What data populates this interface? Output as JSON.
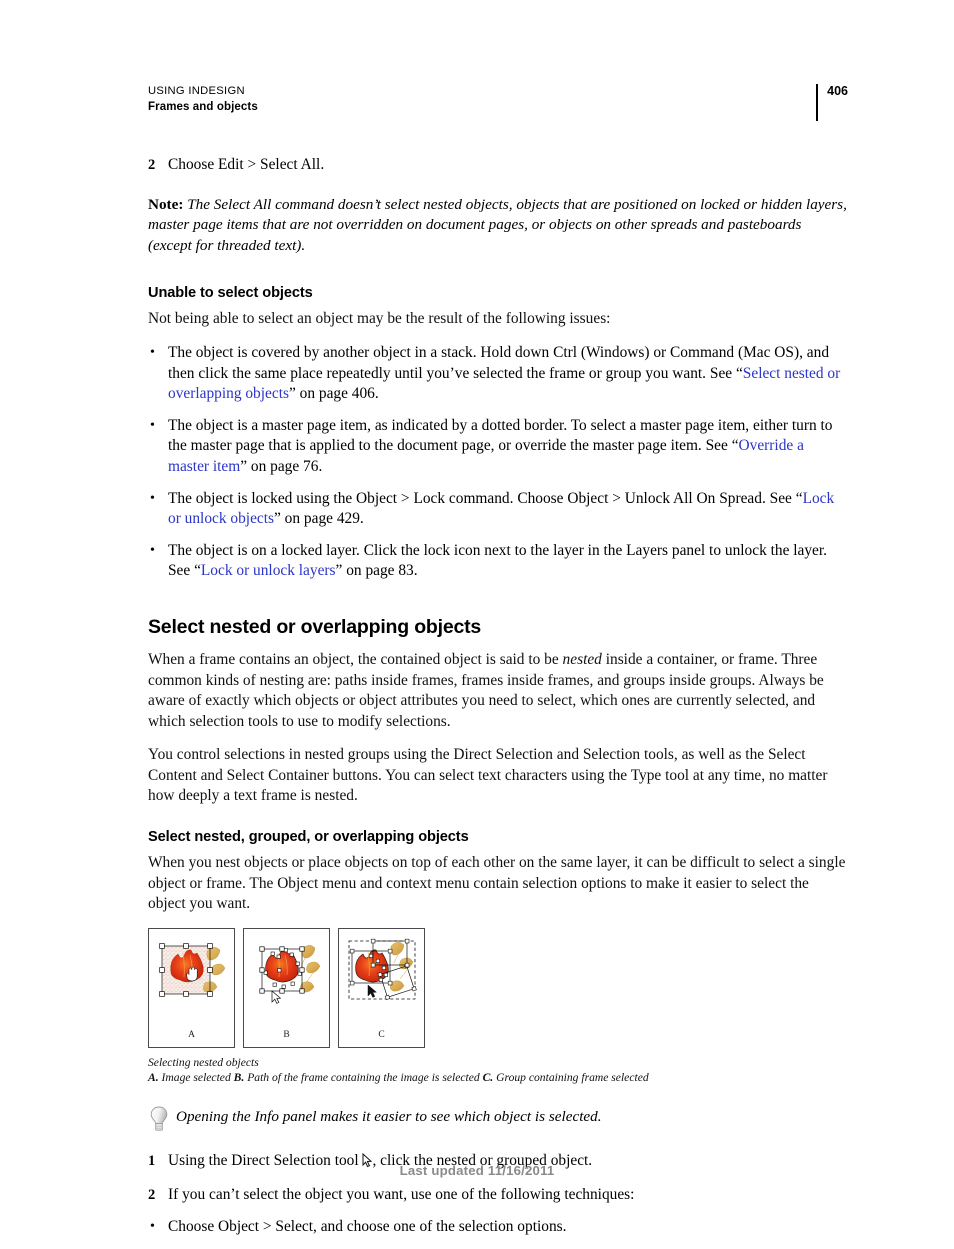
{
  "header": {
    "title": "USING INDESIGN",
    "subtitle": "Frames and objects",
    "page_number": "406"
  },
  "steps_top": {
    "step2_marker": "2",
    "step2_text": "Choose Edit > Select All."
  },
  "note": {
    "label": "Note:",
    "text": " The Select All command doesn’t select nested objects, objects that are positioned on locked or hidden layers, master page items that are not overridden on document pages, or objects on other spreads and pasteboards (except for threaded text)."
  },
  "unable_section": {
    "heading": "Unable to select objects",
    "intro": "Not being able to select an object may be the result of the following issues:",
    "bullets": [
      {
        "marker": "•",
        "part1": "The object is covered by another object in a stack. Hold down Ctrl (Windows) or Command (Mac OS), and then click the same place repeatedly until you’ve selected the frame or group you want. See “",
        "link": "Select nested or overlapping objects",
        "part2": "” on page 406."
      },
      {
        "marker": "•",
        "part1": "The object is a master page item, as indicated by a dotted border. To select a master page item, either turn to the master page that is applied to the document page, or override the master page item. See “",
        "link": "Override a master item",
        "part2": "” on page 76."
      },
      {
        "marker": "•",
        "part1": "The object is locked using the Object > Lock command. Choose Object > Unlock All On Spread. See “",
        "link": "Lock or unlock objects",
        "part2": "” on page 429."
      },
      {
        "marker": "•",
        "part1": "The object is on a locked layer. Click the lock icon next to the layer in the Layers panel to unlock the layer. See “",
        "link": "Lock or unlock layers",
        "part2": "” on page 83."
      }
    ]
  },
  "main_section": {
    "heading": "Select nested or overlapping objects",
    "para1_a": "When a frame contains an object, the contained object is said to be ",
    "para1_italic": "nested",
    "para1_b": " inside a container, or frame. Three common kinds of nesting are: paths inside frames, frames inside frames, and groups inside groups. Always be aware of exactly which objects or object attributes you need to select, which ones are currently selected, and which selection tools to use to modify selections.",
    "para2": "You control selections in nested groups using the Direct Selection and Selection tools, as well as the Select Content and Select Container buttons. You can select text characters using the Type tool at any time, no matter how deeply a text frame is nested."
  },
  "sub_section": {
    "heading": "Select nested, grouped, or overlapping objects",
    "para": "When you nest objects or place objects on top of each other on the same layer, it can be difficult to select a single object or frame. The Object menu and context menu contain selection options to make it easier to select the object you want."
  },
  "figure": {
    "panels": [
      {
        "label": "A",
        "alt": "image-selected-illustration"
      },
      {
        "label": "B",
        "alt": "frame-path-selected-illustration"
      },
      {
        "label": "C",
        "alt": "group-containing-frame-selected-illustration"
      }
    ],
    "caption_title": "Selecting nested objects",
    "caption_keys": [
      {
        "key": "A.",
        "text": " Image selected "
      },
      {
        "key": "B.",
        "text": " Path of the frame containing the image is selected "
      },
      {
        "key": "C.",
        "text": " Group containing frame selected"
      }
    ]
  },
  "tip": {
    "icon": "lightbulb-icon",
    "text": "Opening the Info panel makes it easier to see which object is selected."
  },
  "steps_bottom": [
    {
      "marker": "1",
      "part1": "Using the Direct Selection tool ",
      "icon": "direct-selection-tool-icon",
      "part2": ", click the nested or grouped object."
    },
    {
      "marker": "2",
      "part1": "If you can’t select the object you want, use one of the following techniques:",
      "icon": "",
      "part2": ""
    },
    {
      "marker": "•",
      "part1": "Choose Object > Select, and choose one of the selection options.",
      "icon": "",
      "part2": ""
    }
  ],
  "footer": {
    "text": "Last updated 11/16/2011"
  },
  "colors": {
    "link": "#2b35c8",
    "footer_gray": "#8a8a8a",
    "rule_black": "#000000"
  }
}
